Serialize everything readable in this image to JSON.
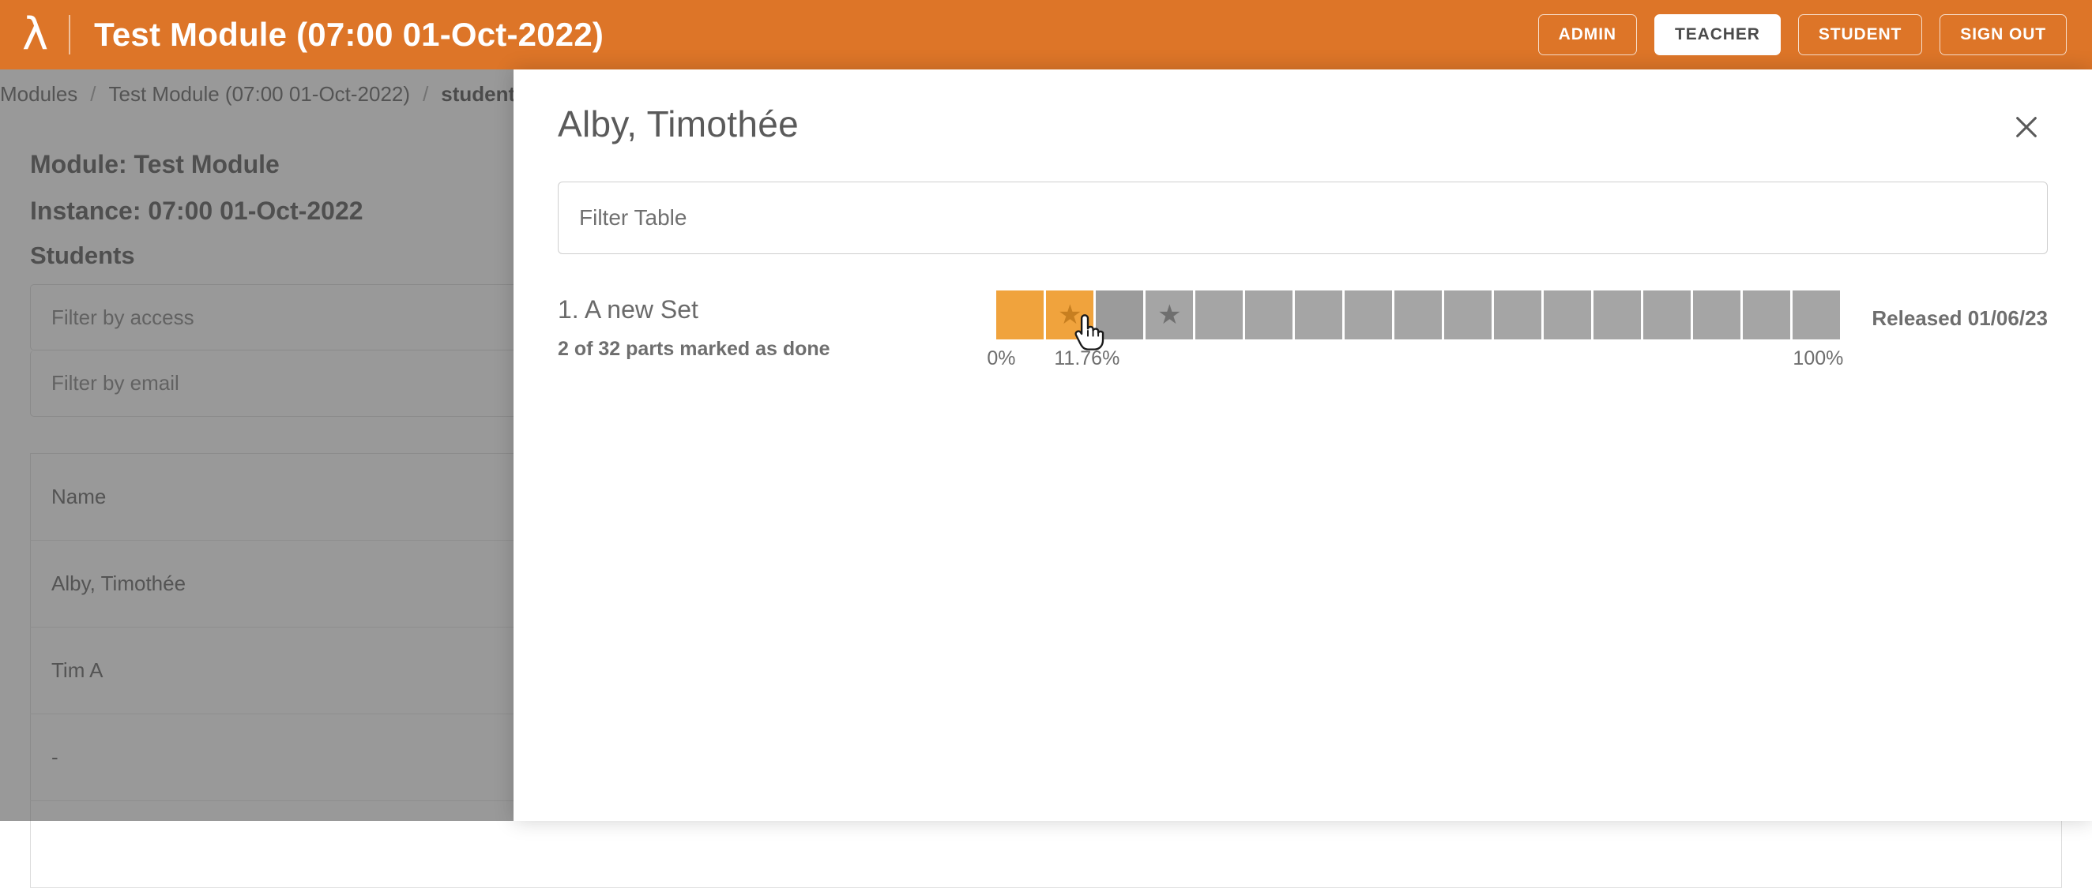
{
  "header": {
    "logo_glyph": "λ",
    "title": "Test Module (07:00 01-Oct-2022)",
    "buttons": [
      {
        "label": "ADMIN",
        "active": false
      },
      {
        "label": "TEACHER",
        "active": true
      },
      {
        "label": "STUDENT",
        "active": false
      },
      {
        "label": "SIGN OUT",
        "active": false
      }
    ],
    "bg_color": "#dd7528"
  },
  "breadcrumb": {
    "items": [
      {
        "label": "Modules",
        "current": false
      },
      {
        "label": "Test Module (07:00 01-Oct-2022)",
        "current": false
      },
      {
        "label": "students",
        "current": true
      }
    ],
    "separator": "/"
  },
  "page": {
    "module_line": "Module: Test Module",
    "instance_line": "Instance: 07:00 01-Oct-2022",
    "students_heading": "Students",
    "filters": [
      {
        "placeholder": "Filter by access"
      },
      {
        "placeholder": "Filter by email"
      }
    ],
    "table": {
      "columns": [
        "Name"
      ],
      "rows": [
        [
          "Alby, Timothée"
        ],
        [
          "Tim A"
        ],
        [
          "-"
        ],
        [
          ""
        ]
      ]
    }
  },
  "modal": {
    "title": "Alby, Timothée",
    "close_icon": "close-icon",
    "filter_placeholder": "Filter Table",
    "sets": [
      {
        "title": "1. A new Set",
        "subtitle": "2 of 32 parts marked as done",
        "released_label": "Released 01/06/23",
        "labels": {
          "start": "0%",
          "current": "11.76%",
          "end": "100%"
        },
        "blocks": [
          {
            "state": "done",
            "star": false
          },
          {
            "state": "done",
            "star": true
          },
          {
            "state": "hover",
            "star": false
          },
          {
            "state": "pending",
            "star": true
          },
          {
            "state": "pending",
            "star": false
          },
          {
            "state": "pending",
            "star": false
          },
          {
            "state": "pending",
            "star": false
          },
          {
            "state": "pending",
            "star": false
          },
          {
            "state": "pending",
            "star": false
          },
          {
            "state": "pending",
            "star": false
          },
          {
            "state": "pending",
            "star": false
          },
          {
            "state": "pending",
            "star": false
          },
          {
            "state": "pending",
            "star": false
          },
          {
            "state": "pending",
            "star": false
          },
          {
            "state": "pending",
            "star": false
          },
          {
            "state": "pending",
            "star": false
          },
          {
            "state": "pending",
            "star": false
          }
        ]
      }
    ]
  },
  "colors": {
    "brand_orange": "#dd7528",
    "progress_done": "#f0a33d",
    "progress_star_done": "#c77f20",
    "progress_pending": "#a5a5a5",
    "progress_star_pending": "#6f6f6f"
  },
  "star_glyph": "★"
}
